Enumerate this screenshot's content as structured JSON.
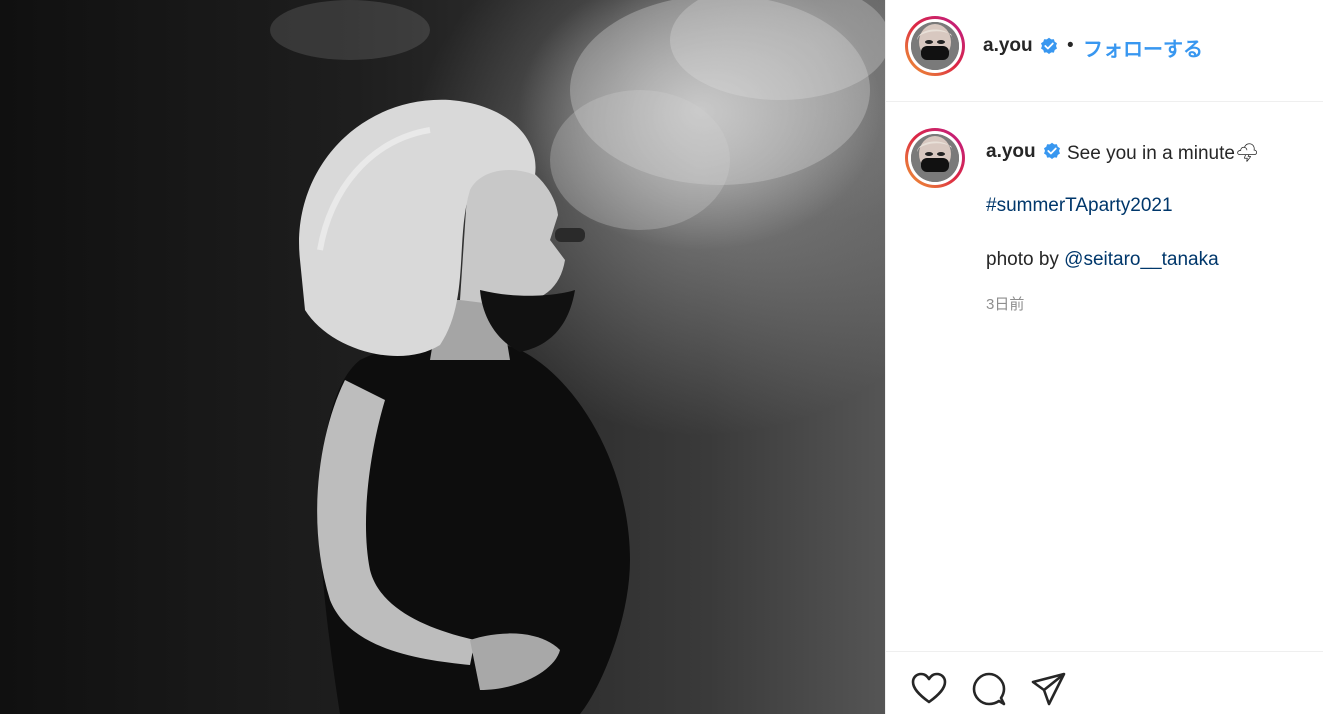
{
  "post": {
    "username": "a.you",
    "verified_icon": "verified-badge-icon",
    "separator": "•",
    "follow_label": "フォローする",
    "caption": "See you in a minute🌩",
    "hashtag": "#summerTAparty2021",
    "credit_prefix": "photo by ",
    "credit_mention": "@seitaro__tanaka",
    "time_ago": "3日前"
  },
  "actions": {
    "icons": [
      "heart-icon",
      "comment-icon",
      "share-icon"
    ]
  },
  "colors": {
    "link_blue": "#3897f0",
    "hashtag_blue": "#00376b",
    "muted": "#8e8e8e",
    "verified": "#3897f0"
  }
}
